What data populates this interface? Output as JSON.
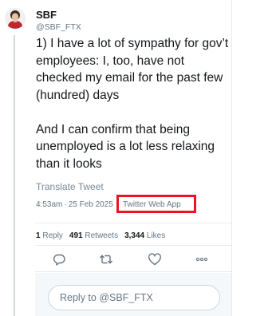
{
  "author": {
    "name": "SBF",
    "handle": "@SBF_FTX"
  },
  "tweet": {
    "paragraphs": [
      "1) I have a lot of sympathy for gov’t employees: I, too, have not checked my email for the past few (hundred) days",
      "And I can confirm that being unemployed is a lot less relaxing than it looks"
    ],
    "translate_label": "Translate Tweet",
    "time": "4:53am",
    "date": "25 Feb 2025",
    "separator": "·",
    "source": "Twitter Web App"
  },
  "stats": {
    "replies_count": "1",
    "replies_label": "Reply",
    "retweets_count": "491",
    "retweets_label": "Retweets",
    "likes_count": "3,344",
    "likes_label": "Likes"
  },
  "actions": {
    "icons": [
      "reply-icon",
      "retweet-icon",
      "like-icon",
      "more-icon"
    ]
  },
  "reply_box": {
    "placeholder": "Reply to @SBF_FTX"
  },
  "colors": {
    "text": "#14171a",
    "muted": "#657786",
    "divider": "#e6ecf0",
    "highlight_box": "#e8141f",
    "avatar_accent": "#c0262d"
  }
}
